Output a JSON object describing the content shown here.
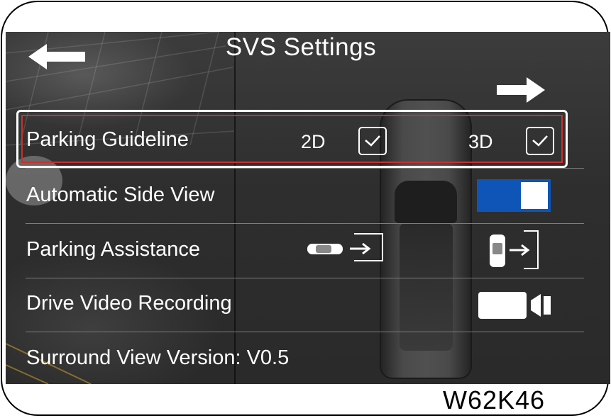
{
  "header": {
    "title": "SVS Settings"
  },
  "settings": {
    "parking_guideline": {
      "label": "Parking Guideline",
      "option_2d": "2D",
      "option_3d": "3D",
      "checked_2d": true,
      "checked_3d": true
    },
    "automatic_side_view": {
      "label": "Automatic Side View",
      "toggle_on": true,
      "toggle_color": "#0f55b8"
    },
    "parking_assistance": {
      "label": "Parking Assistance"
    },
    "drive_video_recording": {
      "label": "Drive Video Recording"
    },
    "version": {
      "label": "Surround View Version: V0.5"
    }
  },
  "highlight_color": "#c9302c",
  "watermark": "W62K46",
  "icons": [
    "back-arrow-icon",
    "forward-arrow-icon",
    "checkmark-icon",
    "car-side-parking-icon",
    "car-rear-parking-icon",
    "video-camera-icon"
  ]
}
